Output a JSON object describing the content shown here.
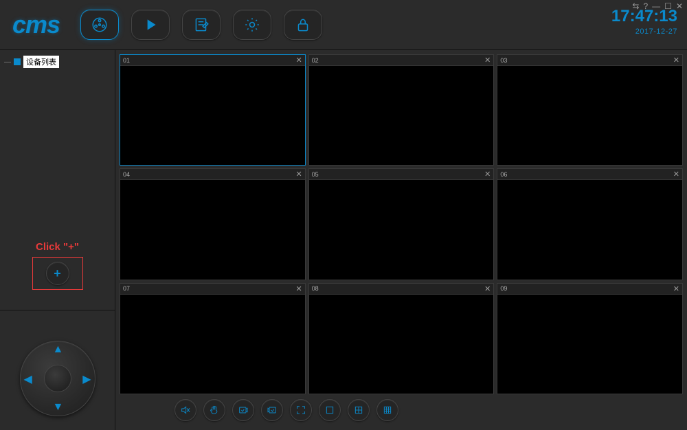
{
  "app": {
    "name": "cms"
  },
  "titlebar": {
    "switch_user": "⇆",
    "help": "?",
    "minimize": "—",
    "maximize": "☐",
    "close": "✕"
  },
  "clock": {
    "time": "17:47:13",
    "date": "2017-12-27"
  },
  "nav": {
    "items": [
      {
        "id": "live",
        "icon": "reel-icon",
        "active": true
      },
      {
        "id": "playback",
        "icon": "play-icon",
        "active": false
      },
      {
        "id": "log",
        "icon": "log-icon",
        "active": false
      },
      {
        "id": "settings",
        "icon": "gear-icon",
        "active": false
      },
      {
        "id": "lock",
        "icon": "lock-icon",
        "active": false
      }
    ]
  },
  "sidebar": {
    "tree_root": "设备列表",
    "add_hint": "Click \"+\"",
    "add_symbol": "+"
  },
  "grid": {
    "cells": [
      {
        "label": "01",
        "selected": true
      },
      {
        "label": "02",
        "selected": false
      },
      {
        "label": "03",
        "selected": false
      },
      {
        "label": "04",
        "selected": false
      },
      {
        "label": "05",
        "selected": false
      },
      {
        "label": "06",
        "selected": false
      },
      {
        "label": "07",
        "selected": false
      },
      {
        "label": "08",
        "selected": false
      },
      {
        "label": "09",
        "selected": false
      }
    ],
    "close_symbol": "✕"
  },
  "toolbar": {
    "items": [
      "mute-icon",
      "hand-icon",
      "snapshot-in-icon",
      "snapshot-out-icon",
      "fullscreen-icon",
      "layout-1-icon",
      "layout-4-icon",
      "layout-9-icon"
    ]
  }
}
